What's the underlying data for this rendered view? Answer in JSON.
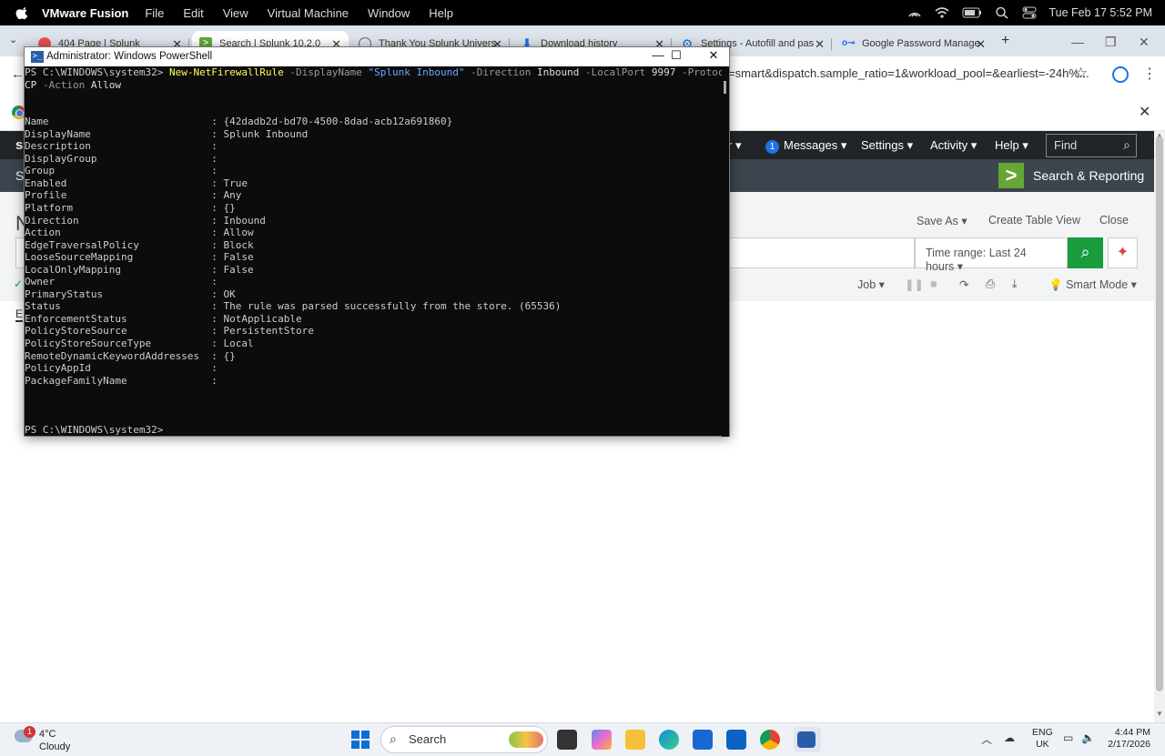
{
  "mac_menu": {
    "app": "VMware Fusion",
    "items": [
      "File",
      "Edit",
      "View",
      "Virtual Machine",
      "Window",
      "Help"
    ],
    "datetime": "Tue Feb 17  5:52 PM"
  },
  "browser": {
    "tabs": [
      {
        "title": "404 Page | Splunk",
        "active": false
      },
      {
        "title": "Search | Splunk 10.2.0",
        "active": true
      },
      {
        "title": "Thank You Splunk Univers",
        "active": false
      },
      {
        "title": "Download history",
        "active": false
      },
      {
        "title": "Settings - Autofill and pas",
        "active": false
      },
      {
        "title": "Google Password Manage",
        "active": false
      }
    ],
    "new_tab": "+",
    "url_fragment": "=smart&dispatch.sample_ratio=1&workload_pool=&earliest=-24h%..."
  },
  "splunk": {
    "logo": "sp",
    "nav": {
      "messages_count": "1",
      "messages": "Messages",
      "settings": "Settings",
      "activity": "Activity",
      "help": "Help",
      "find": "Find"
    },
    "app_left": "S",
    "app_title": "Search & Reporting",
    "page_initial": "N",
    "actions": {
      "save_as": "Save As",
      "create_table_view": "Create Table View",
      "close": "Close"
    },
    "time_range": "Time range: Last 24 hours",
    "job": "Job",
    "smart_mode": "Smart Mode",
    "events_tab": "E"
  },
  "powershell": {
    "title": "Administrator: Windows PowerShell",
    "prompt": "PS C:\\WINDOWS\\system32>",
    "command": {
      "cmdlet": "New-NetFirewallRule",
      "p1": "-DisplayName",
      "v1": "\"Splunk Inbound\"",
      "p2": "-Direction",
      "v2": "Inbound",
      "p3": "-LocalPort",
      "v3": "9997",
      "p4": "-Protocol",
      "v4a": "T",
      "v4b": "CP",
      "p5": "-Action",
      "v5": "Allow"
    },
    "properties": [
      {
        "name": "Name",
        "value": "{42dadb2d-bd70-4500-8dad-acb12a691860}"
      },
      {
        "name": "DisplayName",
        "value": "Splunk Inbound"
      },
      {
        "name": "Description",
        "value": ""
      },
      {
        "name": "DisplayGroup",
        "value": ""
      },
      {
        "name": "Group",
        "value": ""
      },
      {
        "name": "Enabled",
        "value": "True"
      },
      {
        "name": "Profile",
        "value": "Any"
      },
      {
        "name": "Platform",
        "value": "{}"
      },
      {
        "name": "Direction",
        "value": "Inbound"
      },
      {
        "name": "Action",
        "value": "Allow"
      },
      {
        "name": "EdgeTraversalPolicy",
        "value": "Block"
      },
      {
        "name": "LooseSourceMapping",
        "value": "False"
      },
      {
        "name": "LocalOnlyMapping",
        "value": "False"
      },
      {
        "name": "Owner",
        "value": ""
      },
      {
        "name": "PrimaryStatus",
        "value": "OK"
      },
      {
        "name": "Status",
        "value": "The rule was parsed successfully from the store. (65536)"
      },
      {
        "name": "EnforcementStatus",
        "value": "NotApplicable"
      },
      {
        "name": "PolicyStoreSource",
        "value": "PersistentStore"
      },
      {
        "name": "PolicyStoreSourceType",
        "value": "Local"
      },
      {
        "name": "RemoteDynamicKeywordAddresses",
        "value": "{}"
      },
      {
        "name": "PolicyAppId",
        "value": ""
      },
      {
        "name": "PackageFamilyName",
        "value": ""
      }
    ]
  },
  "taskbar": {
    "weather_badge": "1",
    "temp": "4°C",
    "condition": "Cloudy",
    "search": "Search",
    "lang1": "ENG",
    "lang2": "UK",
    "time": "4:44 PM",
    "date": "2/17/2026"
  }
}
